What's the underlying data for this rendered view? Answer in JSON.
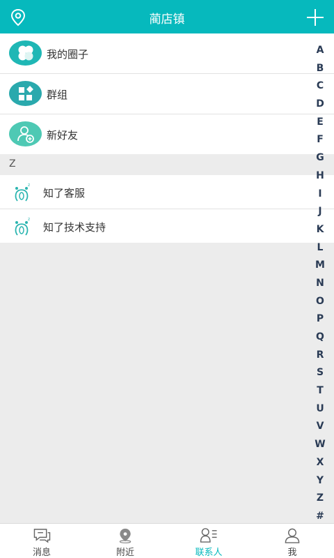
{
  "header": {
    "title": "蔺店镇",
    "location_icon": "location-pin-icon",
    "add_icon": "plus-icon"
  },
  "top_items": [
    {
      "label": "我的圈子",
      "icon": "clover-icon"
    },
    {
      "label": "群组",
      "icon": "group-grid-icon"
    },
    {
      "label": "新好友",
      "icon": "add-friend-icon"
    }
  ],
  "section": {
    "letter": "Z"
  },
  "contacts": [
    {
      "name": "知了客服",
      "icon": "cicada-avatar-icon"
    },
    {
      "name": "知了技术支持",
      "icon": "cicada-avatar-icon"
    }
  ],
  "alphabet": [
    "A",
    "B",
    "C",
    "D",
    "E",
    "F",
    "G",
    "H",
    "I",
    "J",
    "K",
    "L",
    "M",
    "N",
    "O",
    "P",
    "Q",
    "R",
    "S",
    "T",
    "U",
    "V",
    "W",
    "X",
    "Y",
    "Z",
    "#"
  ],
  "tabs": [
    {
      "label": "消息",
      "icon": "chat-bubble-icon",
      "active": false
    },
    {
      "label": "附近",
      "icon": "map-pin-icon",
      "active": false
    },
    {
      "label": "联系人",
      "icon": "contacts-icon",
      "active": true
    },
    {
      "label": "我",
      "icon": "person-icon",
      "active": false
    }
  ],
  "colors": {
    "accent": "#06b9bd",
    "avatar_teal": "#1fb7b5",
    "background": "#ececec"
  }
}
